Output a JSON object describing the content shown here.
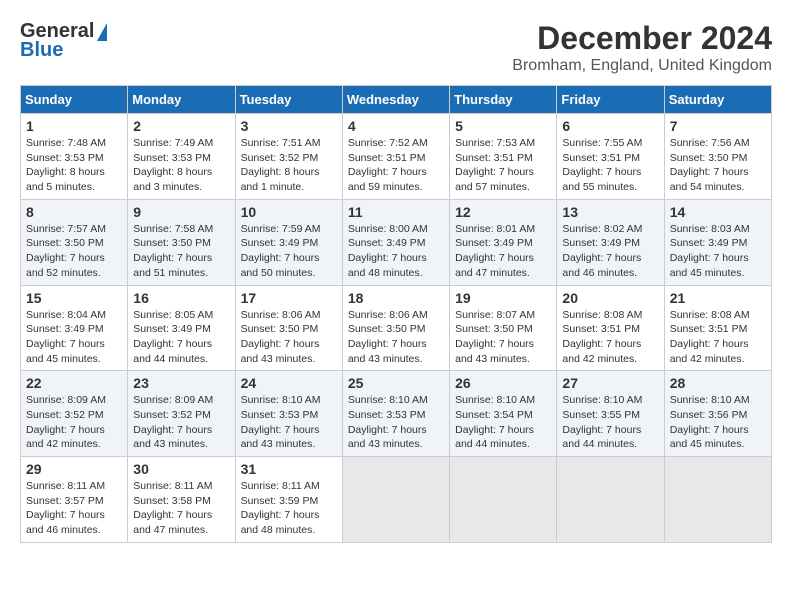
{
  "logo": {
    "line1": "General",
    "line2": "Blue"
  },
  "title": "December 2024",
  "location": "Bromham, England, United Kingdom",
  "days_of_week": [
    "Sunday",
    "Monday",
    "Tuesday",
    "Wednesday",
    "Thursday",
    "Friday",
    "Saturday"
  ],
  "weeks": [
    [
      {
        "day": "1",
        "info": "Sunrise: 7:48 AM\nSunset: 3:53 PM\nDaylight: 8 hours\nand 5 minutes."
      },
      {
        "day": "2",
        "info": "Sunrise: 7:49 AM\nSunset: 3:53 PM\nDaylight: 8 hours\nand 3 minutes."
      },
      {
        "day": "3",
        "info": "Sunrise: 7:51 AM\nSunset: 3:52 PM\nDaylight: 8 hours\nand 1 minute."
      },
      {
        "day": "4",
        "info": "Sunrise: 7:52 AM\nSunset: 3:51 PM\nDaylight: 7 hours\nand 59 minutes."
      },
      {
        "day": "5",
        "info": "Sunrise: 7:53 AM\nSunset: 3:51 PM\nDaylight: 7 hours\nand 57 minutes."
      },
      {
        "day": "6",
        "info": "Sunrise: 7:55 AM\nSunset: 3:51 PM\nDaylight: 7 hours\nand 55 minutes."
      },
      {
        "day": "7",
        "info": "Sunrise: 7:56 AM\nSunset: 3:50 PM\nDaylight: 7 hours\nand 54 minutes."
      }
    ],
    [
      {
        "day": "8",
        "info": "Sunrise: 7:57 AM\nSunset: 3:50 PM\nDaylight: 7 hours\nand 52 minutes."
      },
      {
        "day": "9",
        "info": "Sunrise: 7:58 AM\nSunset: 3:50 PM\nDaylight: 7 hours\nand 51 minutes."
      },
      {
        "day": "10",
        "info": "Sunrise: 7:59 AM\nSunset: 3:49 PM\nDaylight: 7 hours\nand 50 minutes."
      },
      {
        "day": "11",
        "info": "Sunrise: 8:00 AM\nSunset: 3:49 PM\nDaylight: 7 hours\nand 48 minutes."
      },
      {
        "day": "12",
        "info": "Sunrise: 8:01 AM\nSunset: 3:49 PM\nDaylight: 7 hours\nand 47 minutes."
      },
      {
        "day": "13",
        "info": "Sunrise: 8:02 AM\nSunset: 3:49 PM\nDaylight: 7 hours\nand 46 minutes."
      },
      {
        "day": "14",
        "info": "Sunrise: 8:03 AM\nSunset: 3:49 PM\nDaylight: 7 hours\nand 45 minutes."
      }
    ],
    [
      {
        "day": "15",
        "info": "Sunrise: 8:04 AM\nSunset: 3:49 PM\nDaylight: 7 hours\nand 45 minutes."
      },
      {
        "day": "16",
        "info": "Sunrise: 8:05 AM\nSunset: 3:49 PM\nDaylight: 7 hours\nand 44 minutes."
      },
      {
        "day": "17",
        "info": "Sunrise: 8:06 AM\nSunset: 3:50 PM\nDaylight: 7 hours\nand 43 minutes."
      },
      {
        "day": "18",
        "info": "Sunrise: 8:06 AM\nSunset: 3:50 PM\nDaylight: 7 hours\nand 43 minutes."
      },
      {
        "day": "19",
        "info": "Sunrise: 8:07 AM\nSunset: 3:50 PM\nDaylight: 7 hours\nand 43 minutes."
      },
      {
        "day": "20",
        "info": "Sunrise: 8:08 AM\nSunset: 3:51 PM\nDaylight: 7 hours\nand 42 minutes."
      },
      {
        "day": "21",
        "info": "Sunrise: 8:08 AM\nSunset: 3:51 PM\nDaylight: 7 hours\nand 42 minutes."
      }
    ],
    [
      {
        "day": "22",
        "info": "Sunrise: 8:09 AM\nSunset: 3:52 PM\nDaylight: 7 hours\nand 42 minutes."
      },
      {
        "day": "23",
        "info": "Sunrise: 8:09 AM\nSunset: 3:52 PM\nDaylight: 7 hours\nand 43 minutes."
      },
      {
        "day": "24",
        "info": "Sunrise: 8:10 AM\nSunset: 3:53 PM\nDaylight: 7 hours\nand 43 minutes."
      },
      {
        "day": "25",
        "info": "Sunrise: 8:10 AM\nSunset: 3:53 PM\nDaylight: 7 hours\nand 43 minutes."
      },
      {
        "day": "26",
        "info": "Sunrise: 8:10 AM\nSunset: 3:54 PM\nDaylight: 7 hours\nand 44 minutes."
      },
      {
        "day": "27",
        "info": "Sunrise: 8:10 AM\nSunset: 3:55 PM\nDaylight: 7 hours\nand 44 minutes."
      },
      {
        "day": "28",
        "info": "Sunrise: 8:10 AM\nSunset: 3:56 PM\nDaylight: 7 hours\nand 45 minutes."
      }
    ],
    [
      {
        "day": "29",
        "info": "Sunrise: 8:11 AM\nSunset: 3:57 PM\nDaylight: 7 hours\nand 46 minutes."
      },
      {
        "day": "30",
        "info": "Sunrise: 8:11 AM\nSunset: 3:58 PM\nDaylight: 7 hours\nand 47 minutes."
      },
      {
        "day": "31",
        "info": "Sunrise: 8:11 AM\nSunset: 3:59 PM\nDaylight: 7 hours\nand 48 minutes."
      },
      {
        "day": "",
        "info": ""
      },
      {
        "day": "",
        "info": ""
      },
      {
        "day": "",
        "info": ""
      },
      {
        "day": "",
        "info": ""
      }
    ]
  ]
}
